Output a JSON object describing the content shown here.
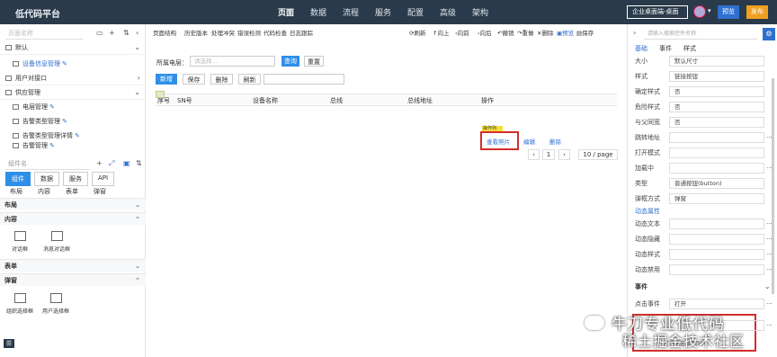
{
  "topbar": {
    "logo": "低代码平台",
    "nav": [
      "页面",
      "数据",
      "流程",
      "服务",
      "配置",
      "高级",
      "架构"
    ],
    "app_select": "企业桌面端-桌面",
    "preview": "预览",
    "publish": "发布"
  },
  "left": {
    "search_placeholder": "页面名称",
    "tree": [
      {
        "label": "默认",
        "level": 0
      },
      {
        "label": "设备信息管理",
        "level": 1,
        "selected": true
      },
      {
        "label": "用户对接口",
        "level": 0
      },
      {
        "label": "供应管理",
        "level": 0
      },
      {
        "label": "电层管理",
        "level": 1
      },
      {
        "label": "告警类型管理",
        "level": 1
      },
      {
        "label": "告警类型管理详情",
        "level": 1
      },
      {
        "label": "告警管理",
        "level": 1
      }
    ],
    "component_search_placeholder": "组件名",
    "tabs": [
      "组件",
      "数据",
      "服务",
      "API"
    ],
    "subtabs": [
      "布局",
      "内容",
      "表单",
      "弹窗"
    ],
    "sections": {
      "layout": "布局",
      "content": "内容",
      "form": "表单",
      "popup": "弹窗"
    },
    "content_items": [
      "对话框",
      "消息对话框"
    ],
    "popup_items": [
      "组织选择框",
      "用户选择框"
    ]
  },
  "center": {
    "toolbar_left": [
      "页面结构",
      "历史版本",
      "处理冲突",
      "错误检测",
      "代码检查",
      "日志跟踪"
    ],
    "toolbar_right": [
      "刷新",
      "向上",
      "向前",
      "向后",
      "撤销",
      "重做",
      "删除",
      "预览",
      "保存"
    ],
    "filter_label": "所属电层：",
    "filter_placeholder": "请选择...",
    "query_btn": "查询",
    "reset_btn": "重置",
    "action_buttons": [
      "新增",
      "保存",
      "删除",
      "刷新"
    ],
    "table_columns": [
      "序号",
      "SN号",
      "设备名称",
      "总线",
      "总线地址",
      "操作"
    ],
    "op_tag": "操作列",
    "op_links": [
      "查看照片",
      "编辑",
      "删除"
    ],
    "pager_page": "1",
    "pager_size": "10 / page"
  },
  "right": {
    "search_placeholder": "请输入搜索控件名称",
    "tabs": [
      "基础",
      "事件",
      "样式"
    ],
    "props": [
      {
        "k": "大小",
        "v": "默认尺寸"
      },
      {
        "k": "样式",
        "v": "链接按钮"
      },
      {
        "k": "确定样式",
        "v": "否"
      },
      {
        "k": "危险样式",
        "v": "否"
      },
      {
        "k": "与父同宽",
        "v": "否"
      },
      {
        "k": "跳转地址",
        "v": ""
      },
      {
        "k": "打开模式",
        "v": ""
      },
      {
        "k": "加载中",
        "v": ""
      },
      {
        "k": "类型",
        "v": "普通按钮(button)"
      },
      {
        "k": "弹框方式",
        "v": "弹窗"
      }
    ],
    "dynamic_title": "动态属性",
    "dynamic_props": [
      "动态文本",
      "动态隐藏",
      "动态样式",
      "动态禁用"
    ],
    "events_title": "事件",
    "event_rows": [
      {
        "k": "点击事件",
        "v": "打开"
      },
      {
        "k": "",
        "v": ""
      }
    ],
    "bottom_hint": "打开弹窗显示图片"
  },
  "watermark": {
    "line1": "牛刀专业低代码",
    "line2": "稀土掘金技术社区"
  }
}
